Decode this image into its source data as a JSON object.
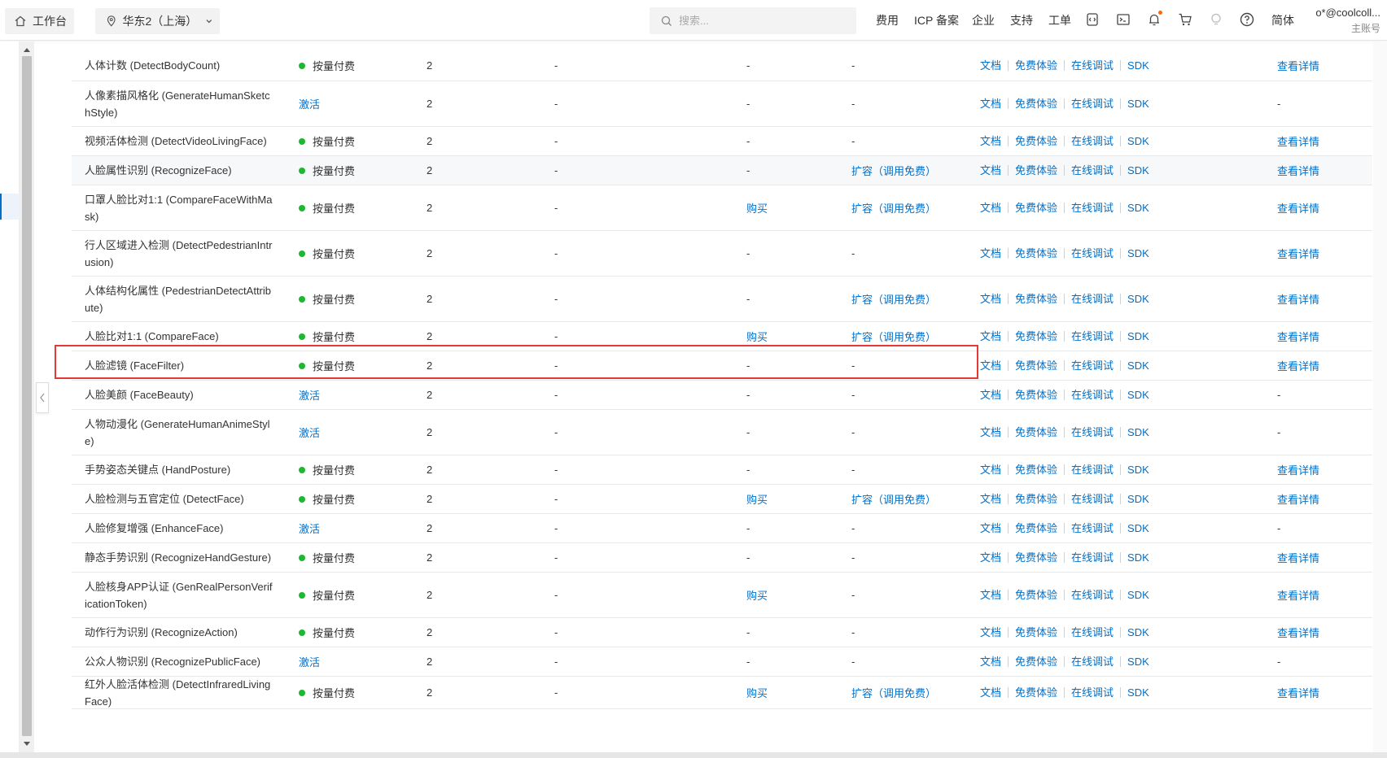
{
  "topbar": {
    "home_label": "工作台",
    "region_label": "华东2（上海）",
    "search_placeholder": "搜索...",
    "nav": [
      "费用",
      "ICP 备案",
      "企业",
      "支持",
      "工单"
    ],
    "lang": "简体",
    "account_name": "o*@coolcoll...",
    "account_type": "主账号",
    "icons": [
      "code-icon",
      "terminal-icon",
      "bell-icon",
      "cart-icon",
      "bulb-icon",
      "help-icon"
    ],
    "accent": "#ff6a00"
  },
  "table": {
    "link_labels": {
      "doc": "文档",
      "trial": "免费体验",
      "debug": "在线调试",
      "sdk": "SDK"
    },
    "rows": [
      {
        "name": "人体计数 (DetectBodyCount)",
        "status": "按量付费",
        "active": true,
        "qps": "2",
        "d1": "-",
        "buy": "-",
        "expand": "-",
        "detail": "查看详情"
      },
      {
        "name": "人像素描风格化 (GenerateHumanSketchStyle)",
        "status": "激活",
        "active": false,
        "qps": "2",
        "d1": "-",
        "buy": "-",
        "expand": "-",
        "detail": "-"
      },
      {
        "name": "视频活体检测 (DetectVideoLivingFace)",
        "status": "按量付费",
        "active": true,
        "qps": "2",
        "d1": "-",
        "buy": "-",
        "expand": "-",
        "detail": "查看详情"
      },
      {
        "name": "人脸属性识别 (RecognizeFace)",
        "status": "按量付费",
        "active": true,
        "qps": "2",
        "d1": "-",
        "buy": "-",
        "expand": "扩容（调用免费）",
        "detail": "查看详情"
      },
      {
        "name": "口罩人脸比对1:1 (CompareFaceWithMask)",
        "status": "按量付费",
        "active": true,
        "qps": "2",
        "d1": "-",
        "buy": "购买",
        "expand": "扩容（调用免费）",
        "detail": "查看详情"
      },
      {
        "name": "行人区域进入检测 (DetectPedestrianIntrusion)",
        "status": "按量付费",
        "active": true,
        "qps": "2",
        "d1": "-",
        "buy": "-",
        "expand": "-",
        "detail": "查看详情"
      },
      {
        "name": "人体结构化属性 (PedestrianDetectAttribute)",
        "status": "按量付费",
        "active": true,
        "qps": "2",
        "d1": "-",
        "buy": "-",
        "expand": "扩容（调用免费）",
        "detail": "查看详情"
      },
      {
        "name": "人脸比对1:1 (CompareFace)",
        "status": "按量付费",
        "active": true,
        "qps": "2",
        "d1": "-",
        "buy": "购买",
        "expand": "扩容（调用免费）",
        "detail": "查看详情"
      },
      {
        "name": "人脸滤镜 (FaceFilter)",
        "status": "按量付费",
        "active": true,
        "qps": "2",
        "d1": "-",
        "buy": "-",
        "expand": "-",
        "detail": "查看详情"
      },
      {
        "name": "人脸美颜 (FaceBeauty)",
        "status": "激活",
        "active": false,
        "qps": "2",
        "d1": "-",
        "buy": "-",
        "expand": "-",
        "detail": "-"
      },
      {
        "name": "人物动漫化 (GenerateHumanAnimeStyle)",
        "status": "激活",
        "active": false,
        "qps": "2",
        "d1": "-",
        "buy": "-",
        "expand": "-",
        "detail": "-"
      },
      {
        "name": "手势姿态关键点 (HandPosture)",
        "status": "按量付费",
        "active": true,
        "qps": "2",
        "d1": "-",
        "buy": "-",
        "expand": "-",
        "detail": "查看详情"
      },
      {
        "name": "人脸检测与五官定位 (DetectFace)",
        "status": "按量付费",
        "active": true,
        "qps": "2",
        "d1": "-",
        "buy": "购买",
        "expand": "扩容（调用免费）",
        "detail": "查看详情"
      },
      {
        "name": "人脸修复增强 (EnhanceFace)",
        "status": "激活",
        "active": false,
        "qps": "2",
        "d1": "-",
        "buy": "-",
        "expand": "-",
        "detail": "-"
      },
      {
        "name": "静态手势识别 (RecognizeHandGesture)",
        "status": "按量付费",
        "active": true,
        "qps": "2",
        "d1": "-",
        "buy": "-",
        "expand": "-",
        "detail": "查看详情"
      },
      {
        "name": "人脸核身APP认证 (GenRealPersonVerificationToken)",
        "status": "按量付费",
        "active": true,
        "qps": "2",
        "d1": "-",
        "buy": "购买",
        "expand": "-",
        "detail": "查看详情"
      },
      {
        "name": "动作行为识别 (RecognizeAction)",
        "status": "按量付费",
        "active": true,
        "qps": "2",
        "d1": "-",
        "buy": "-",
        "expand": "-",
        "detail": "查看详情"
      },
      {
        "name": "公众人物识别 (RecognizePublicFace)",
        "status": "激活",
        "active": false,
        "qps": "2",
        "d1": "-",
        "buy": "-",
        "expand": "-",
        "detail": "-"
      },
      {
        "name": "红外人脸活体检测 (DetectInfraredLivingFace)",
        "status": "按量付费",
        "active": true,
        "qps": "2",
        "d1": "-",
        "buy": "购买",
        "expand": "扩容（调用免费）",
        "detail": "查看详情"
      }
    ]
  },
  "colors": {
    "link": "#0070cc",
    "status_dot": "#1db832",
    "highlight_border": "#e53935"
  }
}
